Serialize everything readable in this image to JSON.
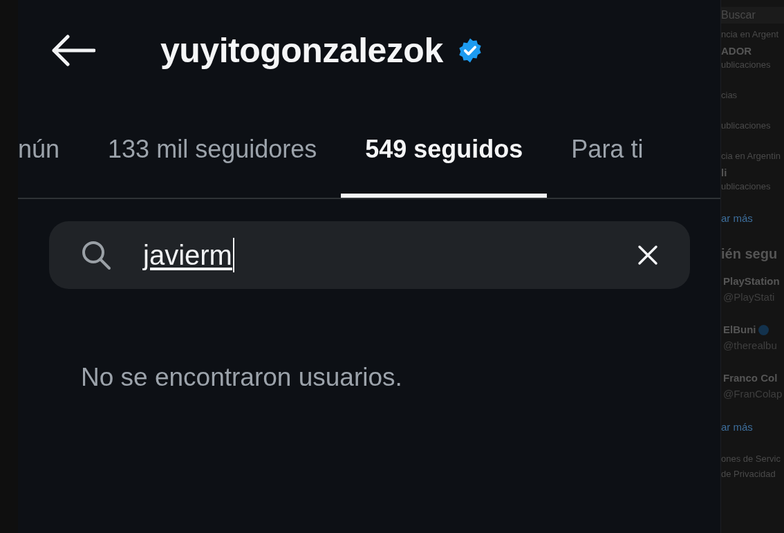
{
  "header": {
    "title": "yuyitogonzalezok",
    "verified": true
  },
  "tabs": [
    {
      "label": "nún",
      "selected": false
    },
    {
      "label": "133 mil seguidores",
      "selected": false
    },
    {
      "label": "549 seguidos",
      "selected": true
    },
    {
      "label": "Para ti",
      "selected": false
    }
  ],
  "search": {
    "value": "javierm"
  },
  "message": "No se encontraron usuarios.",
  "sidebar": {
    "items": [
      {
        "kind": "field",
        "text": "Buscar"
      },
      {
        "kind": "meta",
        "text": "ncia en Argent"
      },
      {
        "kind": "bold",
        "text": "ADOR"
      },
      {
        "kind": "meta",
        "text": "ublicaciones"
      },
      {
        "kind": "gap"
      },
      {
        "kind": "meta",
        "text": "cias"
      },
      {
        "kind": "gap"
      },
      {
        "kind": "meta",
        "text": "ublicaciones"
      },
      {
        "kind": "gap"
      },
      {
        "kind": "meta",
        "text": "cia en Argentin"
      },
      {
        "kind": "bold",
        "text": "li"
      },
      {
        "kind": "meta",
        "text": "ublicaciones"
      },
      {
        "kind": "gap"
      },
      {
        "kind": "link",
        "text": "ar más"
      },
      {
        "kind": "gap"
      },
      {
        "kind": "heading",
        "text": "ién segu"
      },
      {
        "kind": "account",
        "name": "PlayStation",
        "handle": "@PlayStati",
        "verified": false
      },
      {
        "kind": "account",
        "name": "ElBuni",
        "handle": "@therealbu",
        "verified": true
      },
      {
        "kind": "account",
        "name": "Franco Col",
        "handle": "@FranColap",
        "verified": false
      },
      {
        "kind": "link",
        "text": "ar más"
      },
      {
        "kind": "gap"
      },
      {
        "kind": "meta",
        "text": "ones de Servic"
      },
      {
        "kind": "meta",
        "text": "de Privacidad"
      }
    ]
  }
}
